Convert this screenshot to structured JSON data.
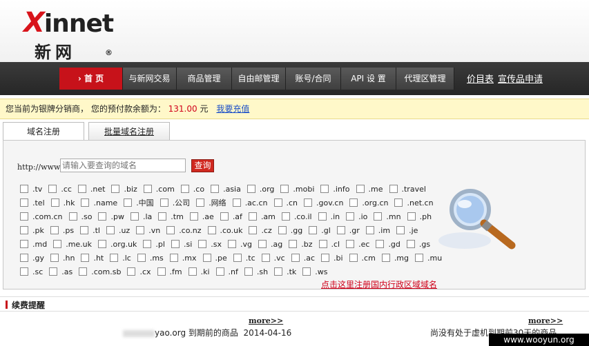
{
  "logo": {
    "brand_x": "X",
    "brand_rest": "innet",
    "cn": "新网",
    "reg": "®"
  },
  "nav": {
    "items": [
      "› 首 页",
      "与新网交易",
      "商品管理",
      "自由邮管理",
      "账号/合同",
      "API 设 置",
      "代理区管理"
    ],
    "links": [
      "价目表",
      "宣传品申请"
    ]
  },
  "notice": {
    "prefix": "您当前为银牌分销商， 您的预付款余额为：",
    "amount": "131.00",
    "unit": "元",
    "recharge": "我要充值"
  },
  "tabs": [
    "域名注册",
    "批量域名注册"
  ],
  "search": {
    "label": "http://www.",
    "placeholder": "请输入要查询的域名",
    "button": "查询"
  },
  "tld_rows": [
    [
      ".tv",
      ".cc",
      ".net",
      ".biz",
      ".com",
      ".co",
      ".asia",
      ".org",
      ".mobi",
      ".info",
      ".me",
      ".travel"
    ],
    [
      ".tel",
      ".hk",
      ".name",
      ".中国",
      ".公司",
      ".网络",
      ".ac.cn",
      ".cn",
      ".gov.cn",
      ".org.cn",
      ".net.cn"
    ],
    [
      ".com.cn",
      ".so",
      ".pw",
      ".la",
      ".tm",
      ".ae",
      ".af",
      ".am",
      ".co.il",
      ".in",
      ".io",
      ".mn",
      ".ph"
    ],
    [
      ".pk",
      ".ps",
      ".tl",
      ".uz",
      ".vn",
      ".co.nz",
      ".co.uk",
      ".cz",
      ".gg",
      ".gl",
      ".gr",
      ".im",
      ".je"
    ],
    [
      ".md",
      ".me.uk",
      ".org.uk",
      ".pl",
      ".si",
      ".sx",
      ".vg",
      ".ag",
      ".bz",
      ".cl",
      ".ec",
      ".gd",
      ".gs"
    ],
    [
      ".gy",
      ".hn",
      ".ht",
      ".lc",
      ".ms",
      ".mx",
      ".pe",
      ".tc",
      ".vc",
      ".ac",
      ".bi",
      ".cm",
      ".mg",
      ".mu"
    ],
    [
      ".sc",
      ".as",
      ".com.sb",
      ".cx",
      ".fm",
      ".ki",
      ".nf",
      ".sh",
      ".tk",
      ".ws"
    ]
  ],
  "region_link": "点击这里注册国内行政区域域名",
  "renew": {
    "title": "续费提醒",
    "more_left": "more>>",
    "more_right": "more>>",
    "expired_text": "yao.org 到期前的商品",
    "expired_date": "2014-04-16",
    "none_text": "尚没有处于虚机到期前30天的商品"
  },
  "watermark": "www.wooyun.org",
  "colors": {
    "accent": "#c7121a",
    "notice_bg": "#fff8c9",
    "amount": "#d0021b",
    "link": "#1a4ec8"
  }
}
